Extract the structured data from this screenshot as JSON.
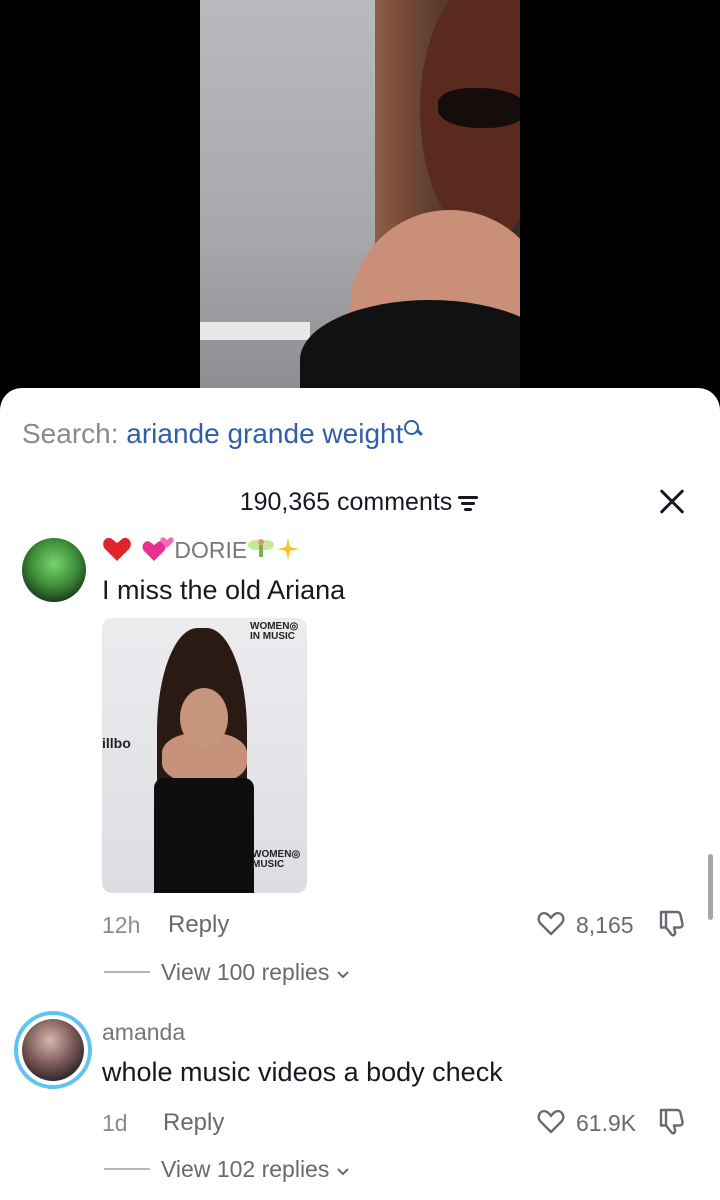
{
  "search": {
    "prefix": "Search:",
    "term": "ariande grande weight"
  },
  "header": {
    "count": "190,365 comments"
  },
  "comments": [
    {
      "username": "DORIE",
      "text": "I miss the old Ariana",
      "time": "12h",
      "reply_label": "Reply",
      "likes": "8,165",
      "view_replies": "View 100 replies",
      "photo_logos": {
        "top": "WOMEN◎ IN MUSIC",
        "left": "illbo",
        "bottom": "WOMEN◎ MUSIC"
      }
    },
    {
      "username": "amanda",
      "text": "whole music videos a body check",
      "time": "1d",
      "reply_label": "Reply",
      "likes": "61.9K",
      "view_replies": "View 102 replies"
    }
  ],
  "icons": [
    "search-icon",
    "filter-icon",
    "close-icon",
    "heart-icon",
    "dislike-icon",
    "chevron-down-icon",
    "red-heart-emoji",
    "pink-hearts-emoji",
    "fairy-emoji",
    "sparkles-emoji"
  ],
  "colors": {
    "search_term": "#2f5fa7",
    "text": "#161823",
    "secondary": "#676a72",
    "ring": "#5fc4f2"
  }
}
